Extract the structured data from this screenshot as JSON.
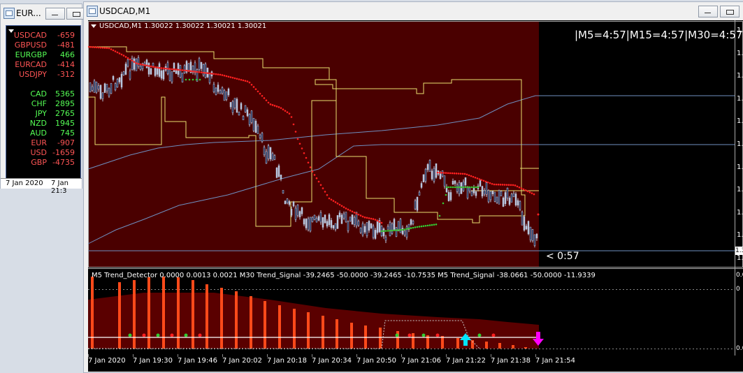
{
  "left_window": {
    "title": "EUR...",
    "rows": [
      {
        "symbol": "USDCAD",
        "value": "-659",
        "color": "#ff5555"
      },
      {
        "symbol": "GBPUSD",
        "value": "-481",
        "color": "#ff5555"
      },
      {
        "symbol": "EURGBP",
        "value": "466",
        "color": "#55ff55"
      },
      {
        "symbol": "EURCAD",
        "value": "-414",
        "color": "#ff5555"
      },
      {
        "symbol": "USDJPY",
        "value": "-312",
        "color": "#ff5555"
      },
      {
        "symbol": "CAD",
        "value": "5365",
        "color": "#55ff55"
      },
      {
        "symbol": "CHF",
        "value": "2895",
        "color": "#55ff55"
      },
      {
        "symbol": "JPY",
        "value": "2765",
        "color": "#55ff55"
      },
      {
        "symbol": "NZD",
        "value": "1945",
        "color": "#55ff55"
      },
      {
        "symbol": "AUD",
        "value": "745",
        "color": "#55ff55"
      },
      {
        "symbol": "EUR",
        "value": "-907",
        "color": "#ff5555"
      },
      {
        "symbol": "USD",
        "value": "-1659",
        "color": "#ff5555"
      },
      {
        "symbol": "GBP",
        "value": "-4735",
        "color": "#ff5555"
      }
    ],
    "dates": [
      "7 Jan 2020",
      "7 Jan 21:3"
    ]
  },
  "main_window": {
    "title": "USDCAD,M1",
    "chart_header": "USDCAD,M1  1.30022 1.30022 1.30021 1.30021",
    "timeframes_text": "|M5=4:57|M15=4:57|M30=4:57",
    "countdown": "< 0:57",
    "indicator_header": "M5 Trend_Detector 0.0000 0.0013 0.0021  M30 Trend_Signal -39.2465 -50.0000 -39.2465 -10.7535  M5 Trend_Signal -38.0661 -50.0000 -11.9339",
    "price_axis_labels": [
      "1.3",
      "1.3",
      "1.3",
      "1.3",
      "1.3",
      "1.3",
      "1.3",
      "1.3",
      "1.3",
      "1.3",
      "1.3"
    ],
    "price_axis_highlight": "1.3",
    "indicator_axis_labels": [
      "0.0",
      "0",
      "0.0"
    ],
    "time_labels": [
      "7 Jan 2020",
      "7 Jan 19:30",
      "7 Jan 19:46",
      "7 Jan 20:02",
      "7 Jan 20:18",
      "7 Jan 20:34",
      "7 Jan 20:50",
      "7 Jan 21:06",
      "7 Jan 21:22",
      "7 Jan 21:38",
      "7 Jan 21:54"
    ]
  },
  "colors": {
    "chart_bg": "#4a0000",
    "candle": "#b8c8e0",
    "red_dots": "#ff2020",
    "green_dots": "#33cc33",
    "yellow_line": "#e8e070",
    "blue_line": "#6f8fc0",
    "histogram": "#ff4a1a",
    "arrow_up": "#00e5ff",
    "arrow_down": "#ff00ff"
  }
}
